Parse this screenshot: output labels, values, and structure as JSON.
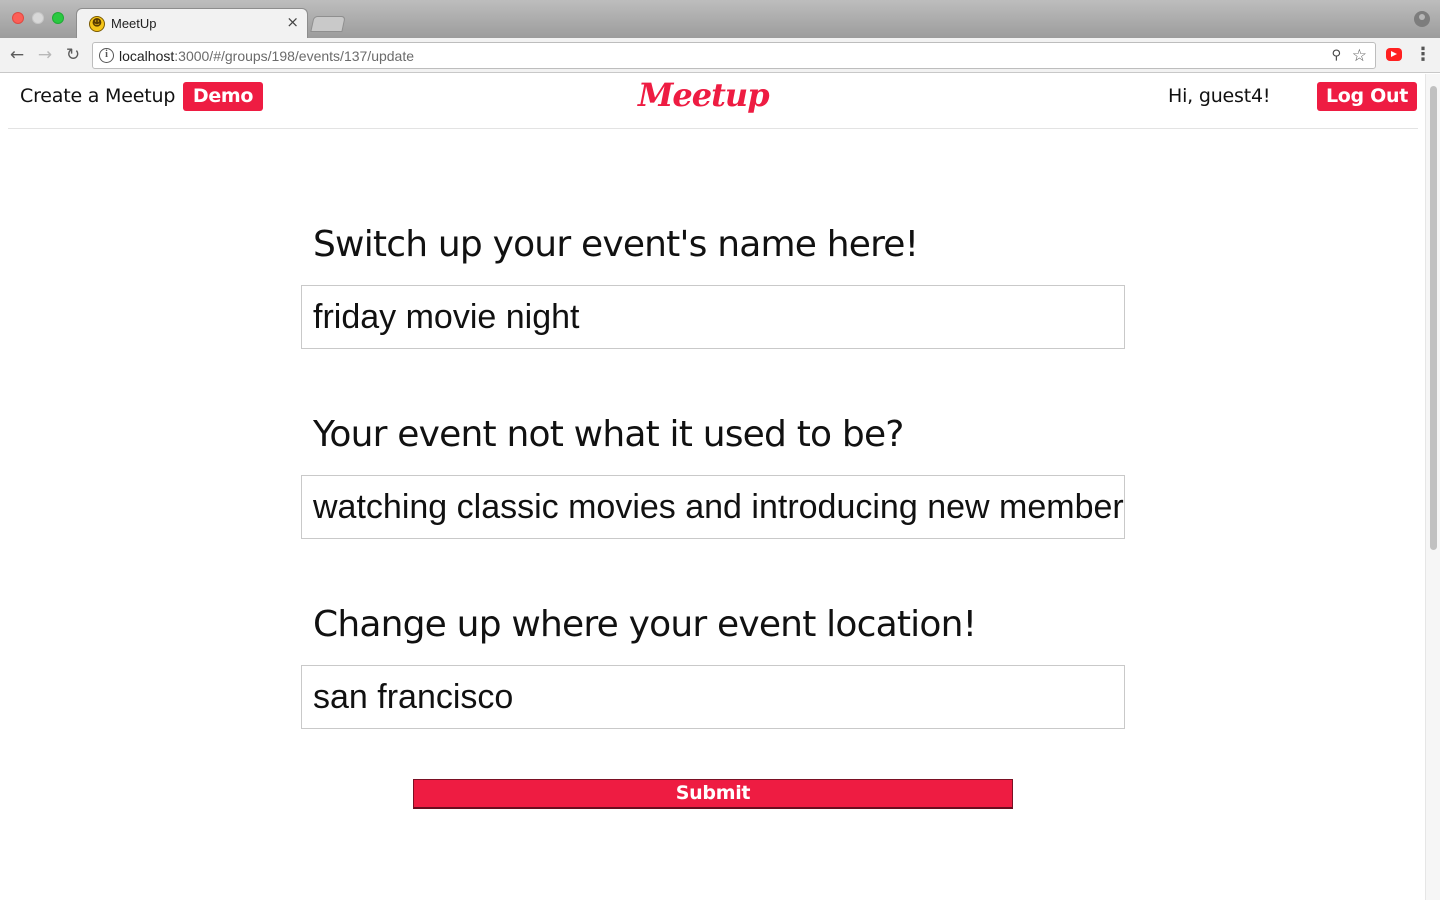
{
  "browser": {
    "tab_title": "MeetUp",
    "tab_close": "×",
    "url_host": "localhost",
    "url_path": ":3000/#/groups/198/events/137/update"
  },
  "nav": {
    "create_link": "Create a Meetup",
    "demo_label": "Demo",
    "logo_text": "Meetup",
    "greeting": "Hi, guest4!",
    "logout_label": "Log Out"
  },
  "form": {
    "name_label": "Switch up your event's name here!",
    "name_value": "friday movie night",
    "description_label": "Your event not what it used to be?",
    "description_value": "watching classic movies and introducing new members",
    "location_label": "Change up where your event location!",
    "location_value": "san francisco",
    "submit_label": "Submit"
  },
  "colors": {
    "accent": "#ee1c42"
  }
}
